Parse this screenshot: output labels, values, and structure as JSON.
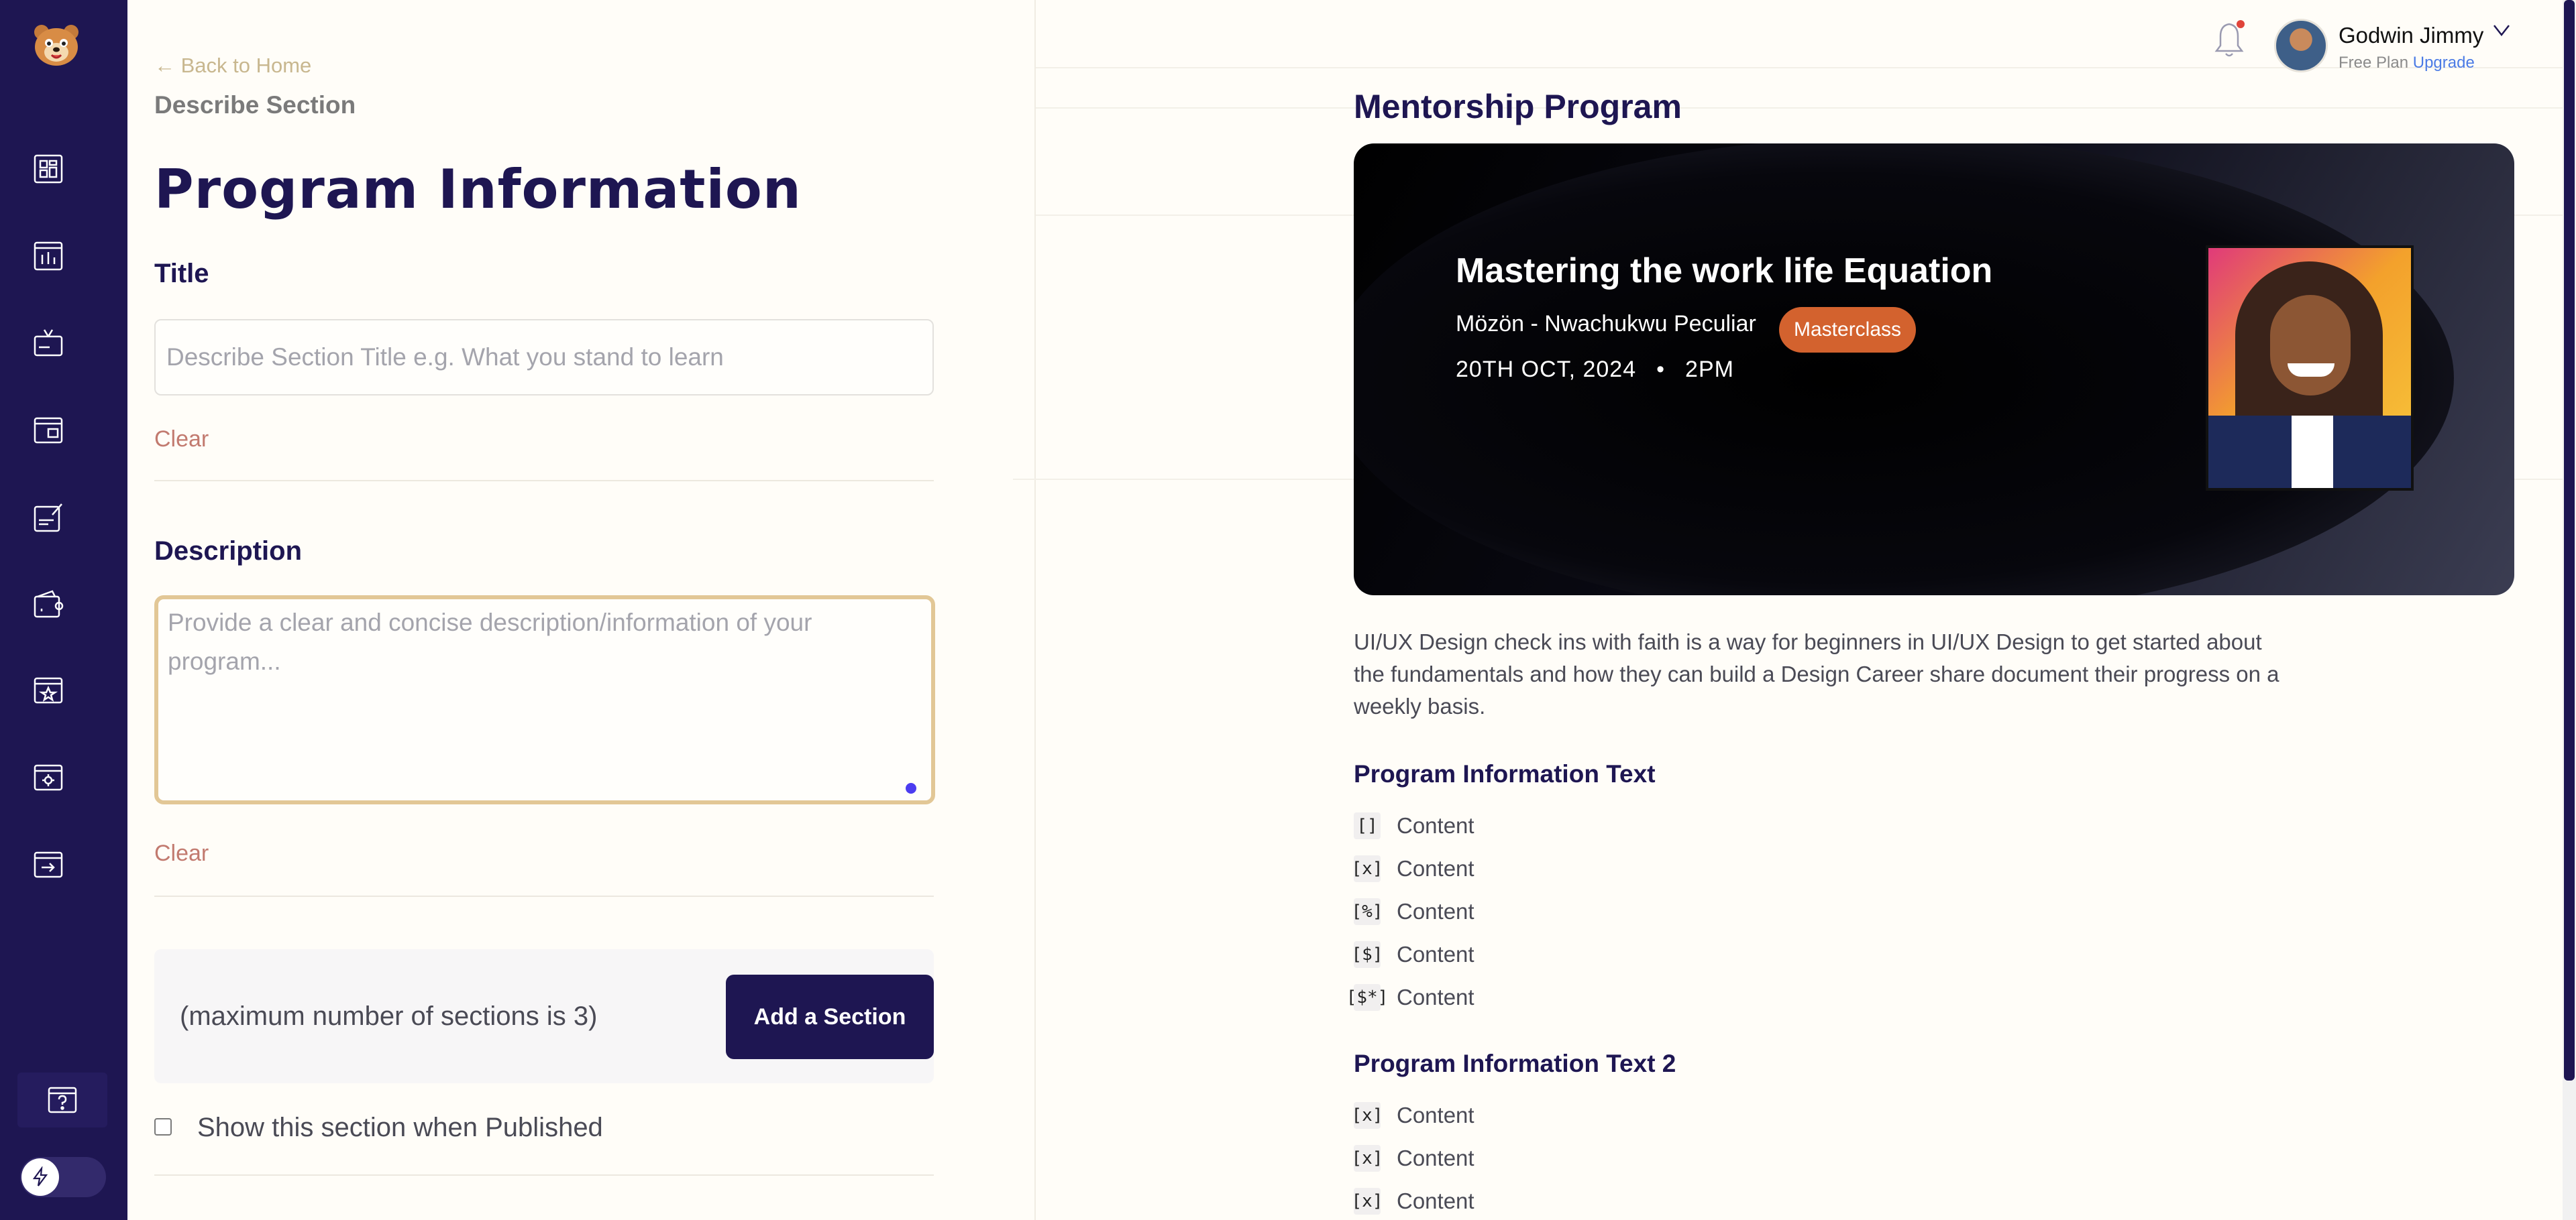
{
  "sidebar": {
    "items": [
      {
        "name": "dashboard-icon"
      },
      {
        "name": "analytics-icon"
      },
      {
        "name": "media-icon"
      },
      {
        "name": "layout-icon"
      },
      {
        "name": "edit-document-icon"
      },
      {
        "name": "wallet-icon"
      },
      {
        "name": "favorites-icon"
      },
      {
        "name": "settings-icon"
      },
      {
        "name": "logout-icon"
      }
    ],
    "help_icon": "question-icon",
    "theme_toggle_icon": "lightning-icon"
  },
  "editor": {
    "back_link": "← Back to Home",
    "section_caption": "Describe Section",
    "page_title": "Program Information",
    "title_label": "Title",
    "title_placeholder": "Describe Section Title e.g. What you stand to learn",
    "clear_label": "Clear",
    "description_label": "Description",
    "description_placeholder": "Provide a clear and concise description/information of your program...",
    "sections_note": "(maximum number of sections is 3)",
    "add_section_button": "Add a Section",
    "publish_label": "Show this section when Published"
  },
  "header": {
    "user_name": "Godwin Jimmy",
    "plan": "Free Plan",
    "upgrade": "Upgrade"
  },
  "preview": {
    "title": "Mentorship Program",
    "banner": {
      "title": "Mastering the work life Equation",
      "author": "Mözön - Nwachukwu Peculiar",
      "badge": "Masterclass",
      "date": "20TH OCT, 2024",
      "separator": "•",
      "time": "2PM"
    },
    "description": "UI/UX Design check ins with faith is a way for beginners in UI/UX Design to get started about the fundamentals and how they can build a Design Career share document their progress on a weekly basis.",
    "sections": [
      {
        "heading": "Program Information Text",
        "items": [
          {
            "tag": "[]",
            "text": "Content"
          },
          {
            "tag": "[x]",
            "text": "Content"
          },
          {
            "tag": "[%]",
            "text": "Content"
          },
          {
            "tag": "[$]",
            "text": "Content"
          },
          {
            "tag": "[$*]",
            "text": "Content"
          }
        ]
      },
      {
        "heading": "Program Information Text 2",
        "items": [
          {
            "tag": "[x]",
            "text": "Content"
          },
          {
            "tag": "[x]",
            "text": "Content"
          },
          {
            "tag": "[x]",
            "text": "Content"
          }
        ]
      }
    ]
  },
  "colors": {
    "sidebar": "#1e1652",
    "accent": "#1e1652",
    "clear_link": "#c27a6f",
    "badge": "#d3622e",
    "upgrade_link": "#4b7be5",
    "focus_border": "#e2c796"
  }
}
